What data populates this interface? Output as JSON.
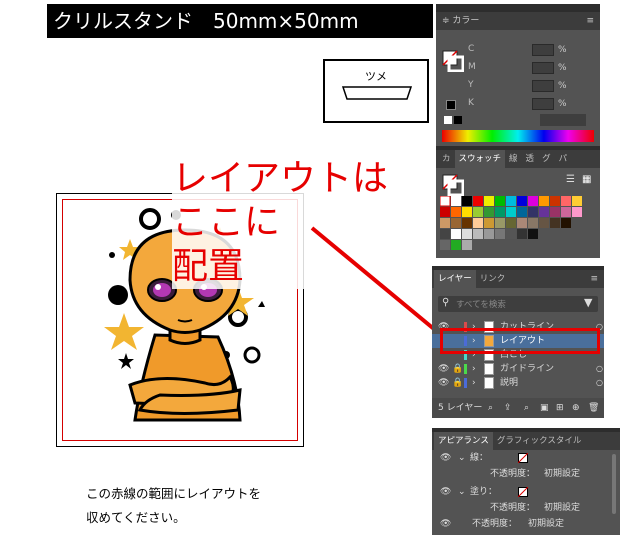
{
  "artboard": {
    "title": "クリルスタンド　50mm×50mm",
    "tsume_label": "ツメ",
    "callout_line1": "レイアウトは",
    "callout_line2": "ここに",
    "callout_line3": "配置",
    "instruction_line1": "この赤線の範囲にレイアウトを",
    "instruction_line2": "収めてください。"
  },
  "color_panel": {
    "title": "カラー",
    "channels": [
      {
        "label": "C",
        "unit": "%"
      },
      {
        "label": "M",
        "unit": "%"
      },
      {
        "label": "Y",
        "unit": "%"
      },
      {
        "label": "K",
        "unit": "%"
      }
    ]
  },
  "swatch_panel": {
    "tabs": [
      "カ",
      "スウォッチ",
      "線",
      "透",
      "グ",
      "パ"
    ]
  },
  "layers_panel": {
    "tabs": [
      "レイヤー",
      "リンク"
    ],
    "search_placeholder": "すべてを検索",
    "layers": [
      {
        "name": "カットライン",
        "color": "#d94b4b"
      },
      {
        "name": "レイアウト",
        "color": "#4b6bd9",
        "selected": true
      },
      {
        "name": "白こし",
        "color": "#4bd9c8"
      },
      {
        "name": "ガイドライン",
        "color": "#4bd94b"
      },
      {
        "name": "説明",
        "color": "#4b6bd9"
      }
    ],
    "footer_count": "5 レイヤー"
  },
  "appearance_panel": {
    "tabs": [
      "アピアランス",
      "グラフィックスタイル"
    ],
    "rows": [
      {
        "label": "線：",
        "value": ""
      },
      {
        "label": "不透明度：",
        "value": "初期設定"
      },
      {
        "label": "塗り：",
        "value": ""
      },
      {
        "label": "不透明度：",
        "value": "初期設定"
      },
      {
        "label": "不透明度：",
        "value": "初期設定"
      }
    ]
  },
  "colors": {
    "callout_red": "#e60000",
    "panel_bg": "#535353",
    "selected_layer": "#4a6f9c"
  }
}
